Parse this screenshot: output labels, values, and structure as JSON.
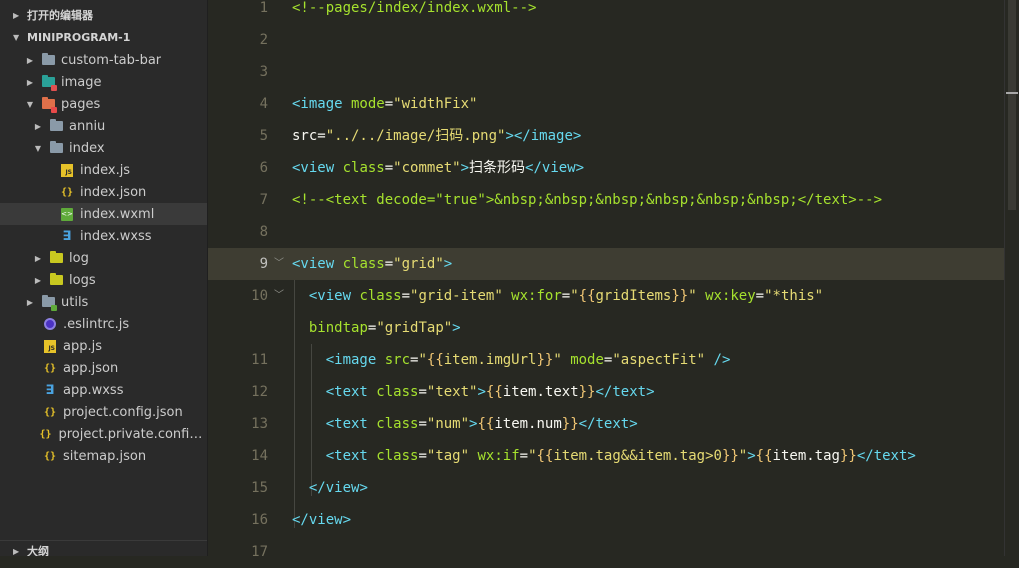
{
  "sidebar": {
    "open_editors": "打开的编辑器",
    "project": "MINIPROGRAM-1",
    "outline": "大纲",
    "items": [
      {
        "label": "custom-tab-bar",
        "icon": "folder-icon"
      },
      {
        "label": "image",
        "icon": "image-folder-icon"
      },
      {
        "label": "pages",
        "icon": "pages-folder-icon"
      },
      {
        "label": "anniu",
        "icon": "folder-icon"
      },
      {
        "label": "index",
        "icon": "folder-open-icon"
      },
      {
        "label": "index.js",
        "icon": "js-file-icon"
      },
      {
        "label": "index.json",
        "icon": "json-file-icon"
      },
      {
        "label": "index.wxml",
        "icon": "wxml-file-icon"
      },
      {
        "label": "index.wxss",
        "icon": "wxss-file-icon"
      },
      {
        "label": "log",
        "icon": "folder-icon"
      },
      {
        "label": "logs",
        "icon": "folder-icon"
      },
      {
        "label": "utils",
        "icon": "utils-folder-icon"
      },
      {
        "label": ".eslintrc.js",
        "icon": "eslint-file-icon"
      },
      {
        "label": "app.js",
        "icon": "js-file-icon"
      },
      {
        "label": "app.json",
        "icon": "json-file-icon"
      },
      {
        "label": "app.wxss",
        "icon": "wxss-file-icon"
      },
      {
        "label": "project.config.json",
        "icon": "json-file-icon"
      },
      {
        "label": "project.private.config.js...",
        "icon": "json-file-icon"
      },
      {
        "label": "sitemap.json",
        "icon": "json-file-icon"
      }
    ]
  },
  "editor": {
    "lines": [
      {
        "n": "1",
        "text": "<!--pages/index/index.wxml-->"
      },
      {
        "n": "2",
        "text": ""
      },
      {
        "n": "3",
        "text": ""
      },
      {
        "n": "4",
        "text": "<image mode=\"widthFix\""
      },
      {
        "n": "",
        "text": "src=\"../../image/扫码.png\"></image>"
      },
      {
        "n": "5",
        "text": "<view class=\"commet\">扫条形码</view>"
      },
      {
        "n": "6",
        "text": "<!--<text decode=\"true\">&nbsp;&nbsp;&nbsp;&nbsp;&nbsp;&nbsp;</text>-->"
      },
      {
        "n": "7",
        "text": ""
      },
      {
        "n": "8",
        "text": "<view class=\"grid\">"
      },
      {
        "n": "9",
        "text": "  <view class=\"grid-item\" wx:for=\"{{gridItems}}\" wx:key=\"*this\""
      },
      {
        "n": "10",
        "text": "  bindtap=\"gridTap\">"
      },
      {
        "n": "11",
        "text": "    <image src=\"{{item.imgUrl}}\" mode=\"aspectFit\" />"
      },
      {
        "n": "12",
        "text": "    <text class=\"text\">{{item.text}}</text>"
      },
      {
        "n": "13",
        "text": "    <text class=\"num\">{{item.num}}</text>"
      },
      {
        "n": "14",
        "text": "    <text class=\"tag\" wx:if=\"{{item.tag&&item.tag>0}}\">{{item.tag}}</text>"
      },
      {
        "n": "15",
        "text": "  </view>"
      },
      {
        "n": "16",
        "text": "</view>"
      },
      {
        "n": "17",
        "text": ""
      }
    ],
    "gutter_numbers": [
      "1",
      "2",
      "3",
      "4",
      "5",
      "6",
      "7",
      "8",
      "9",
      "10",
      "",
      "11",
      "12",
      "13",
      "14",
      "15",
      "16",
      "17"
    ]
  },
  "colors": {
    "bg": "#272822",
    "sidebar": "#2a2a2a",
    "tag": "#66d9ef",
    "string": "#e6db74",
    "comment": "#a6e22e"
  }
}
